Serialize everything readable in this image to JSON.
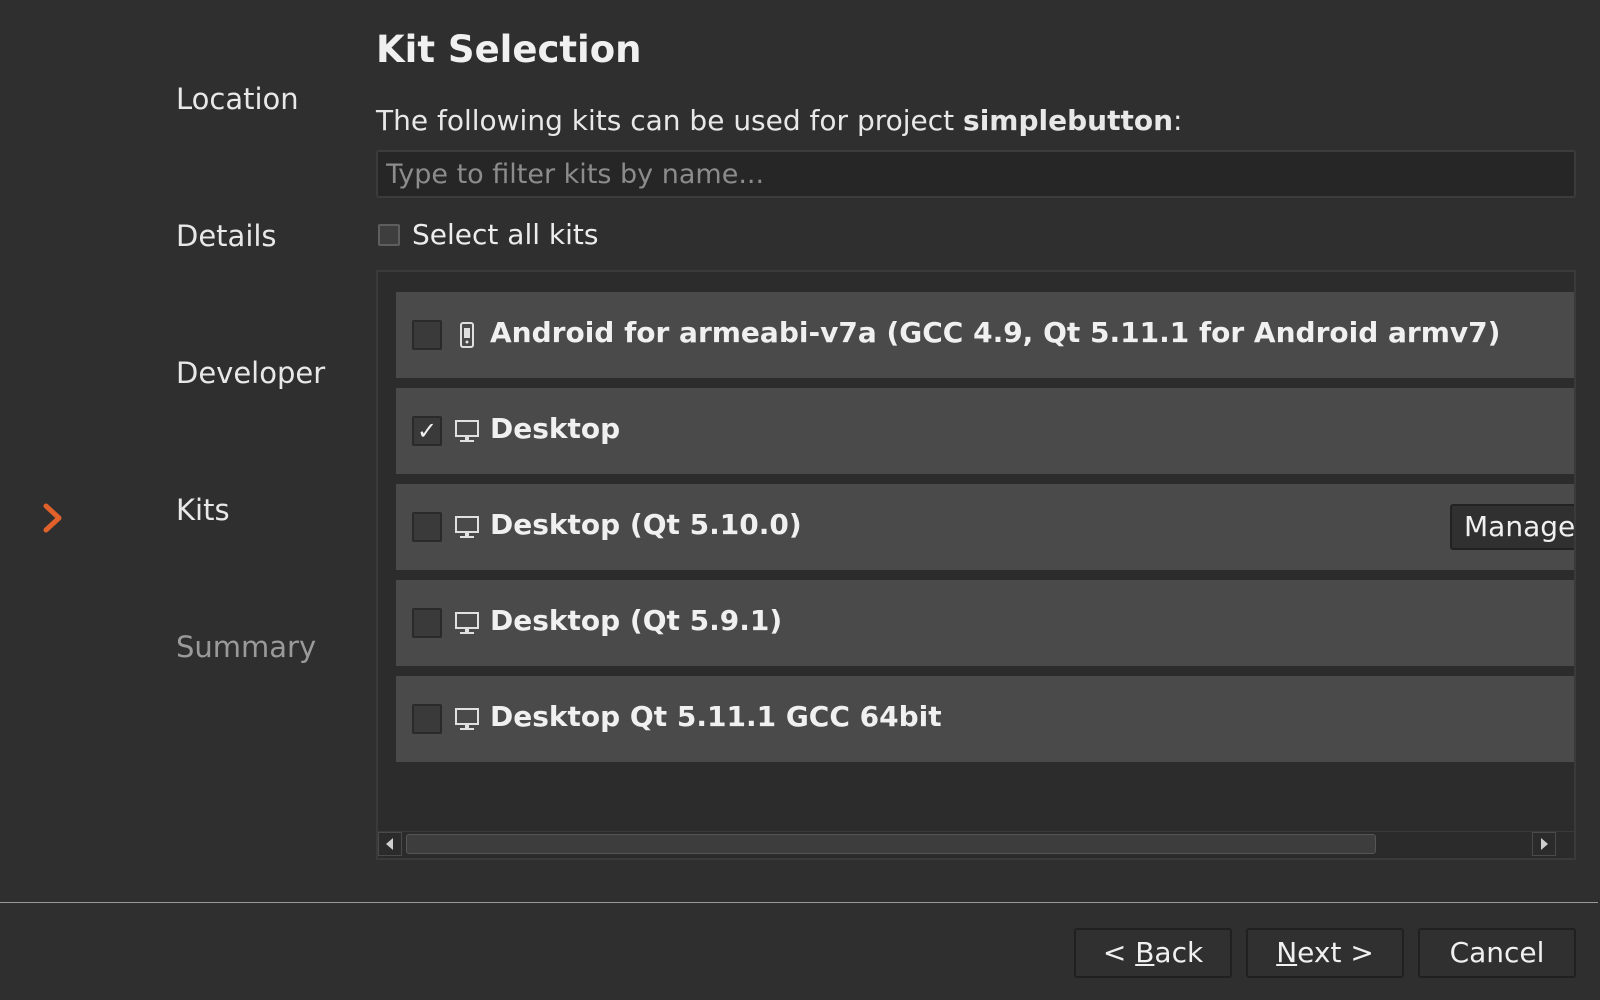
{
  "steps": [
    {
      "label": "Location"
    },
    {
      "label": "Details"
    },
    {
      "label": "Developer"
    },
    {
      "label": "Kits",
      "current": true
    },
    {
      "label": "Summary"
    }
  ],
  "page": {
    "title": "Kit Selection",
    "subtitle_prefix": "The following kits can be used for project ",
    "project_name": "simplebutton",
    "subtitle_suffix": ":"
  },
  "filter": {
    "placeholder": "Type to filter kits by name...",
    "value": ""
  },
  "select_all": {
    "label": "Select all kits",
    "checked": false
  },
  "kits": [
    {
      "label": "Android for armeabi-v7a (GCC 4.9, Qt 5.11.1 for Android armv7)",
      "checked": false,
      "icon": "android-device-icon"
    },
    {
      "label": "Desktop",
      "checked": true,
      "icon": "monitor-icon"
    },
    {
      "label": "Desktop (Qt 5.10.0)",
      "checked": false,
      "icon": "monitor-icon",
      "manage_label": "Manage..."
    },
    {
      "label": "Desktop (Qt 5.9.1)",
      "checked": false,
      "icon": "monitor-icon"
    },
    {
      "label": "Desktop Qt 5.11.1 GCC 64bit",
      "checked": false,
      "icon": "monitor-icon"
    }
  ],
  "footer": {
    "back": {
      "before": "< ",
      "mnemonic": "B",
      "after": "ack"
    },
    "next": {
      "before": "",
      "mnemonic": "N",
      "after": "ext >"
    },
    "cancel": "Cancel"
  },
  "colors": {
    "background": "#2f2f2f",
    "row": "#4a4a4a",
    "accent_arrow": "#e0622a"
  },
  "check_glyph": "✓"
}
